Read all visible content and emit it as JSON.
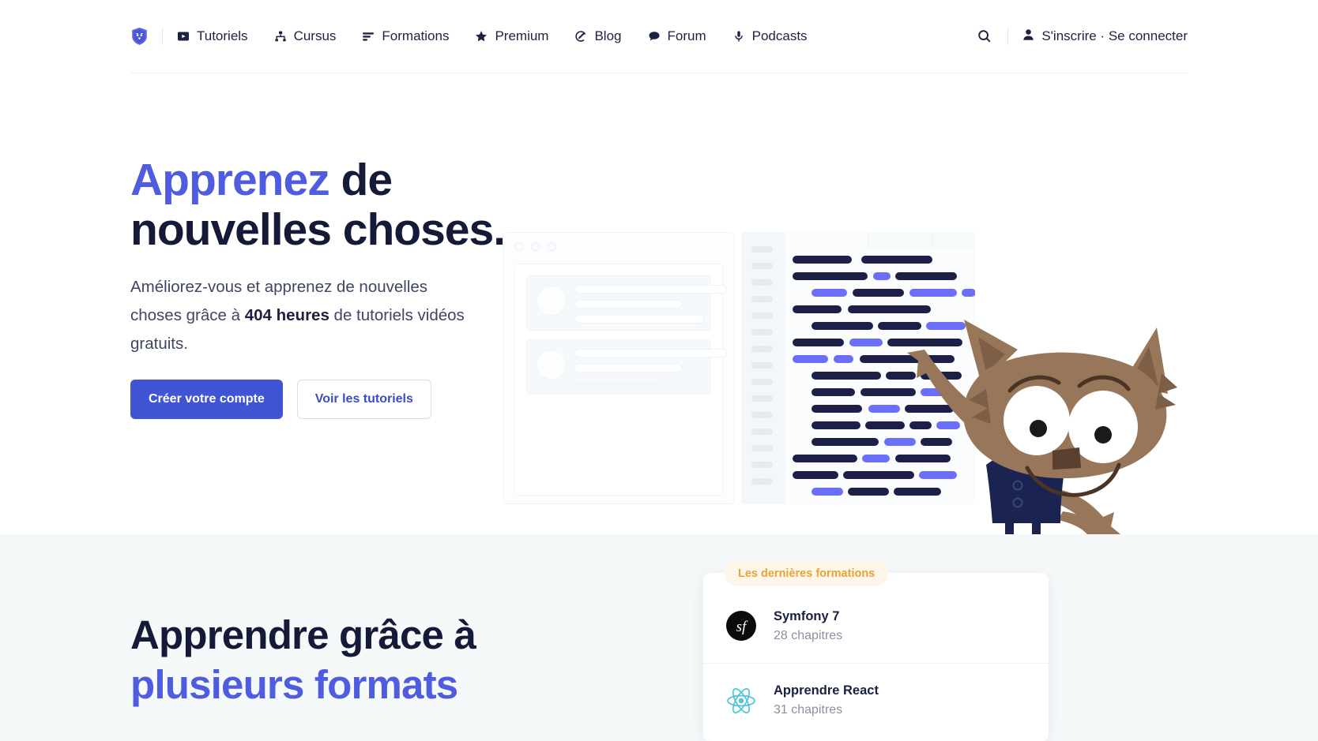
{
  "colors": {
    "accent_blue": "#4f5ce0",
    "button_blue": "#4055d4",
    "dark_navy": "#151a38",
    "code_dark": "#1c2048",
    "code_blue": "#6a6ef8",
    "badge_orange": "#e9a33b",
    "section_bg": "#f5f9fa",
    "mascot_fur": "#97765a",
    "mascot_vest": "#1b2450"
  },
  "nav": {
    "logo_icon": "shield-owl-logo-icon",
    "items": [
      {
        "label": "Tutoriels",
        "icon": "play-square-icon"
      },
      {
        "label": "Cursus",
        "icon": "sitemap-icon"
      },
      {
        "label": "Formations",
        "icon": "lines-list-icon"
      },
      {
        "label": "Premium",
        "icon": "star-icon"
      },
      {
        "label": "Blog",
        "icon": "pencil-circle-icon"
      },
      {
        "label": "Forum",
        "icon": "speech-bubble-icon"
      },
      {
        "label": "Podcasts",
        "icon": "microphone-icon"
      }
    ],
    "search_icon": "search-icon",
    "auth": {
      "icon": "user-icon",
      "label": "S'inscrire · Se connecter",
      "signup_label": "S'inscrire",
      "separator": "·",
      "login_label": "Se connecter"
    }
  },
  "hero": {
    "title_accent": "Apprenez",
    "title_rest": " de nouvelles choses.",
    "subtitle_pre": "Améliorez-vous et apprenez de nouvelles choses grâce à ",
    "subtitle_bold": "404 heures",
    "subtitle_post": " de tutoriels vidéos gratuits.",
    "primary_button": "Créer votre compte",
    "secondary_button": "Voir les tutoriels",
    "illustration": {
      "mockup_window_name": "browser-mockup-panel",
      "editor_name": "code-editor-mockup-panel",
      "mascot_name": "fox-mascot-illustration"
    }
  },
  "section_formats": {
    "title_line1": "Apprendre grâce à",
    "title_line2": "plusieurs formats"
  },
  "formations": {
    "badge": "Les dernières formations",
    "items": [
      {
        "name": "Symfony 7",
        "chapters": "28 chapitres",
        "logo": "symfony-logo-icon"
      },
      {
        "name": "Apprendre React",
        "chapters": "31 chapitres",
        "logo": "react-logo-icon"
      }
    ]
  }
}
